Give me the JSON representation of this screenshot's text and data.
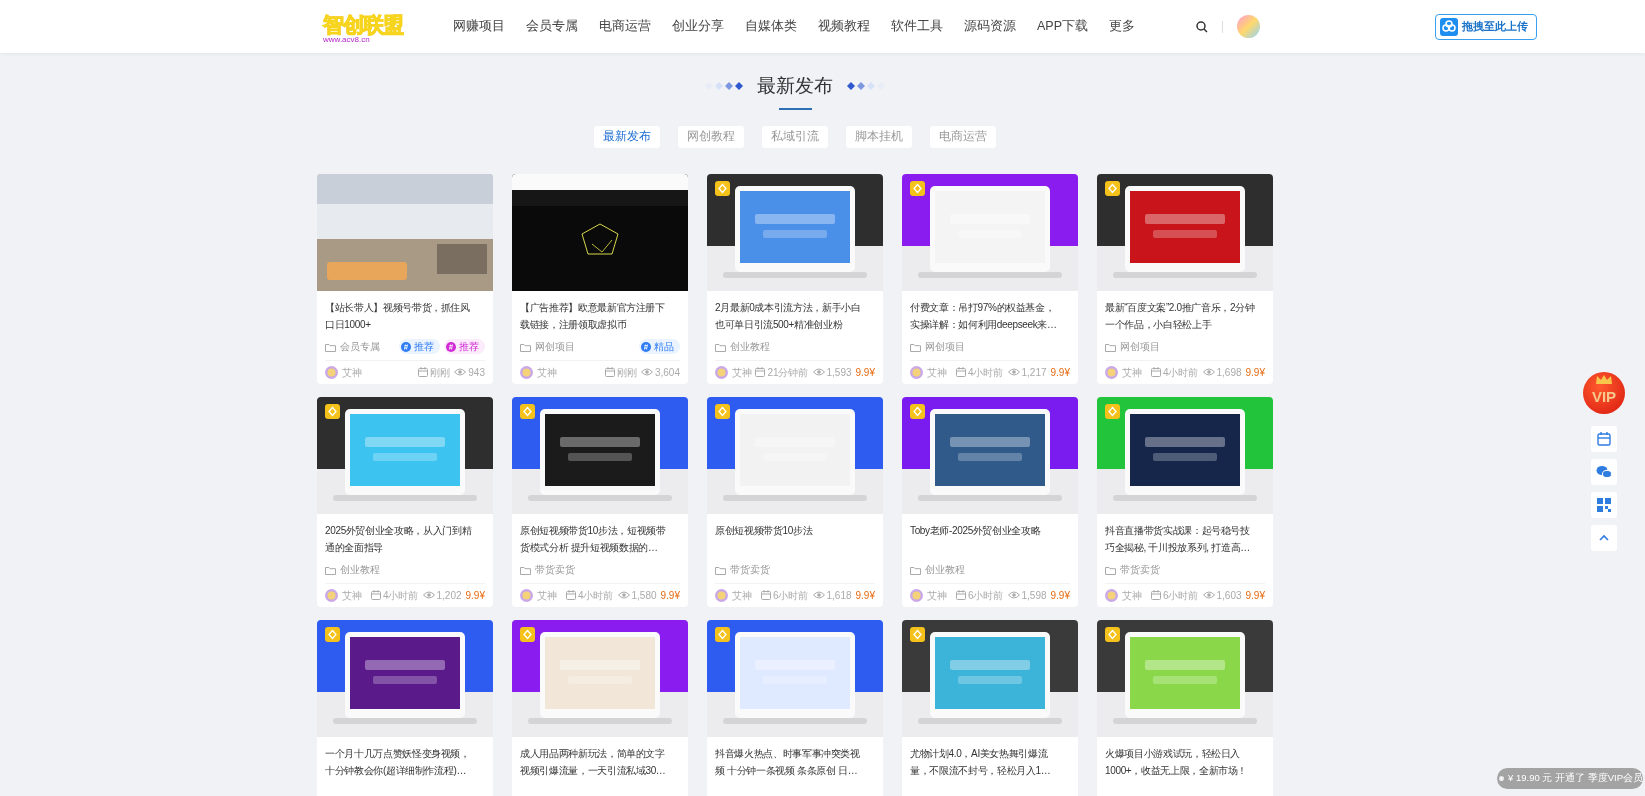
{
  "header": {
    "logo": {
      "title": "智创联盟",
      "url": "www.acv8.cn"
    },
    "nav": [
      "网赚项目",
      "会员专属",
      "电商运营",
      "创业分享",
      "自媒体类",
      "视频教程",
      "软件工具",
      "源码资源",
      "APP下载",
      "更多"
    ],
    "upload_button": "拖拽至此上传"
  },
  "section": {
    "title": "最新发布",
    "tabs": [
      {
        "label": "最新发布",
        "selected": true
      },
      {
        "label": "网创教程",
        "selected": false
      },
      {
        "label": "私域引流",
        "selected": false
      },
      {
        "label": "脚本挂机",
        "selected": false
      },
      {
        "label": "电商运营",
        "selected": false
      }
    ]
  },
  "cards": [
    {
      "title": "【站长带人】视频号带货，抓住风口日1000+",
      "category": "会员专属",
      "tags": [
        {
          "label": "推荐",
          "color": "#2f7cf6"
        },
        {
          "label": "推荐",
          "color": "#d12ad6"
        }
      ],
      "author": "艾神",
      "time": "刚刚",
      "views": "943",
      "vip_badge": false
    },
    {
      "title": "【广告推荐】欧意最新官方注册下载链接，注册领取虚拟币",
      "category": "网创项目",
      "tags": [
        {
          "label": "精品",
          "color": "#2f7cf6"
        }
      ],
      "author": "艾神",
      "time": "刚刚",
      "views": "3,604",
      "vip_badge": false
    },
    {
      "title": "2月最新0成本引流方法，新手小白也可单日引流500+精准创业粉",
      "category": "创业教程",
      "author": "艾神",
      "time": "21分钟前",
      "views": "1,593",
      "price": "9.9¥",
      "vip_badge": true
    },
    {
      "title": "付费文章：吊打97%的权益基金，实操详解：如何利用deepseek来…",
      "category": "网创项目",
      "author": "艾神",
      "time": "4小时前",
      "views": "1,217",
      "price": "9.9¥",
      "vip_badge": true
    },
    {
      "title": "最新“百度文案”2.0推广音乐，2分钟一个作品，小白轻松上手",
      "category": "网创项目",
      "author": "艾神",
      "time": "4小时前",
      "views": "1,698",
      "price": "9.9¥",
      "vip_badge": true
    },
    {
      "title": "2025外贸创业全攻略，从入门到精通的全面指导",
      "category": "创业教程",
      "author": "艾神",
      "time": "4小时前",
      "views": "1,202",
      "price": "9.9¥",
      "vip_badge": true
    },
    {
      "title": "原创短视频带货10步法，短视频带货模式分析 提升短视频数据的…",
      "category": "带货卖货",
      "author": "艾神",
      "time": "4小时前",
      "views": "1,580",
      "price": "9.9¥",
      "vip_badge": true
    },
    {
      "title": "原创短视频带货10步法",
      "category": "带货卖货",
      "author": "艾神",
      "time": "6小时前",
      "views": "1,618",
      "price": "9.9¥",
      "vip_badge": true
    },
    {
      "title": "Toby老师-2025外贸创业全攻略",
      "category": "创业教程",
      "author": "艾神",
      "time": "6小时前",
      "views": "1,598",
      "price": "9.9¥",
      "vip_badge": true
    },
    {
      "title": "抖音直播带货实战课：起号稳号技巧全揭秘, 千川投放系列, 打造高…",
      "category": "带货卖货",
      "author": "艾神",
      "time": "6小时前",
      "views": "1,603",
      "price": "9.9¥",
      "vip_badge": true
    },
    {
      "title": "一个月十几万点赞妖怪变身视频，十分钟教会你(超详细制作流程)…",
      "vip_badge": true
    },
    {
      "title": "成人用品两种新玩法，简单的文字视频引爆流量，一天引流私域30…",
      "vip_badge": true
    },
    {
      "title": "抖音爆火热点、时事军事冲突类视频 十分钟一条视频 条条原创 日…",
      "vip_badge": true
    },
    {
      "title": "尤物计划4.0，AI美女热舞引爆流量，不限流不封号，轻松月入1…",
      "vip_badge": true
    },
    {
      "title": "火爆项目小游戏试玩，轻松日入1000+，收益无上限，全新市场！",
      "vip_badge": true
    }
  ],
  "floating": {
    "vip_label": "VIP"
  },
  "purchase_toast": "¥ 19.90 元 开通了 季度VIP会员"
}
